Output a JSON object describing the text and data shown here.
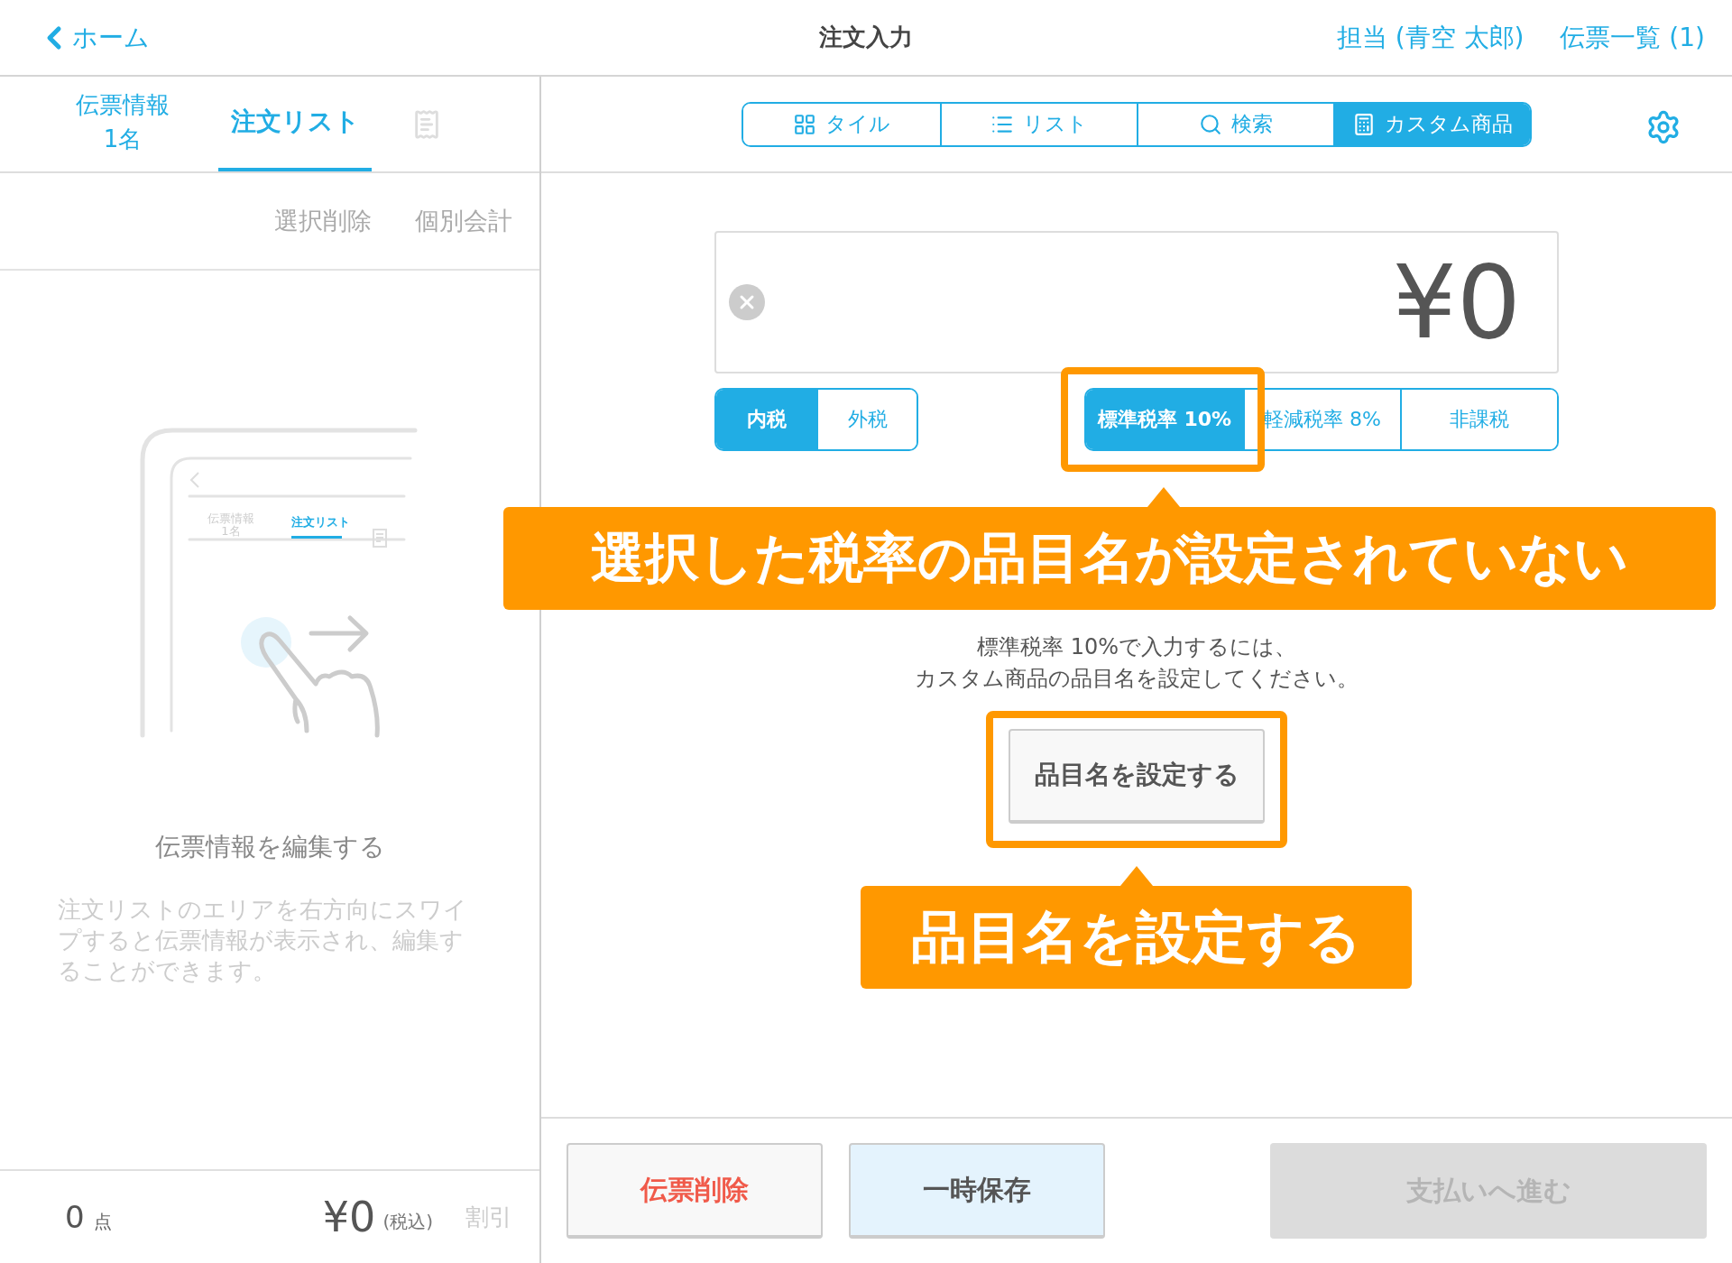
{
  "header": {
    "back_label": "ホーム",
    "title": "注文入力",
    "staff": "担当 (青空 太郎)",
    "slips": "伝票一覧 (1)"
  },
  "left_tabs": [
    {
      "label": "伝票情報",
      "sub": "1名",
      "selected": false
    },
    {
      "label": "注文リスト",
      "selected": true
    }
  ],
  "actions": [
    "選択削除",
    "個別会計"
  ],
  "illustration": {
    "tab_info": "伝票情報",
    "tab_count": "1名",
    "tab_list": "注文リスト"
  },
  "empty_state": {
    "title": "伝票情報を編集する",
    "description": "注文リストのエリアを右方向にスワイプすると伝票情報が表示され、編集することができます。"
  },
  "footer": {
    "count": "0",
    "count_unit": "点",
    "total": "¥0",
    "tax_note": "(税込)",
    "discount": "割引"
  },
  "view_tabs": [
    {
      "kind": "tile",
      "label": "タイル",
      "selected": false
    },
    {
      "kind": "list",
      "label": "リスト",
      "selected": false
    },
    {
      "kind": "search",
      "label": "検索",
      "selected": false
    },
    {
      "kind": "custom",
      "label": "カスタム商品",
      "selected": true
    }
  ],
  "amount": "¥0",
  "tax_modes": [
    {
      "label": "内税",
      "selected": true
    },
    {
      "label": "外税",
      "selected": false
    }
  ],
  "tax_rates": [
    {
      "label": "標準税率 10%",
      "selected": true
    },
    {
      "label": "軽減税率 8%",
      "selected": false
    },
    {
      "label": "非課税",
      "selected": false
    }
  ],
  "message": [
    "標準税率 10%で入力するには、",
    "カスタム商品の品目名を設定してください。"
  ],
  "set_name_button": "品目名を設定する",
  "callouts": [
    "選択した税率の品目名が設定されていない",
    "品目名を設定する"
  ],
  "bottom_buttons": [
    {
      "kind": "danger",
      "label": "伝票削除",
      "disabled": false
    },
    {
      "kind": "save",
      "label": "一時保存",
      "disabled": false
    },
    {
      "kind": "primary",
      "label": "支払いへ進む",
      "disabled": true
    }
  ]
}
